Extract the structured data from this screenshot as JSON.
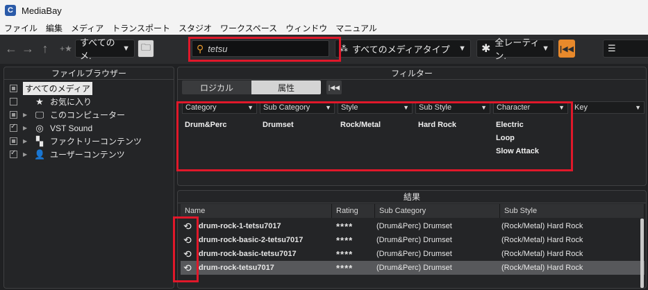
{
  "window": {
    "title": "MediaBay"
  },
  "menu": [
    "ファイル",
    "編集",
    "メディア",
    "トランスポート",
    "スタジオ",
    "ワークスペース",
    "ウィンドウ",
    "マニュアル"
  ],
  "toolbar": {
    "location_label": "すべてのメ.",
    "search_value": "tetsu",
    "media_type": "すべてのメディアタイプ",
    "rating": "全レーティン."
  },
  "browser": {
    "title": "ファイルブラウザー",
    "items": [
      {
        "label": "すべてのメディア",
        "check": "partial",
        "arrow": false,
        "icon": ""
      },
      {
        "label": "お気に入り",
        "check": "none",
        "arrow": false,
        "icon": "★"
      },
      {
        "label": "このコンピューター",
        "check": "partial",
        "arrow": true,
        "icon": "🖵"
      },
      {
        "label": "VST Sound",
        "check": "checked",
        "arrow": true,
        "icon": "◎"
      },
      {
        "label": "ファクトリーコンテンツ",
        "check": "partial",
        "arrow": true,
        "icon": "▚"
      },
      {
        "label": "ユーザーコンテンツ",
        "check": "checked",
        "arrow": true,
        "icon": "👤"
      }
    ]
  },
  "filter": {
    "title": "フィルター",
    "tab_logical": "ロジカル",
    "tab_attribute": "属性",
    "columns": [
      {
        "label": "Category",
        "values": [
          "Drum&Perc"
        ]
      },
      {
        "label": "Sub Category",
        "values": [
          "Drumset"
        ]
      },
      {
        "label": "Style",
        "values": [
          "Rock/Metal"
        ]
      },
      {
        "label": "Sub Style",
        "values": [
          "Hard Rock"
        ]
      },
      {
        "label": "Character",
        "values": [
          "Electric",
          "Loop",
          "Slow Attack"
        ]
      },
      {
        "label": "Key",
        "values": []
      }
    ]
  },
  "results": {
    "title": "結果",
    "columns": [
      "Name",
      "Rating",
      "Sub Category",
      "Sub Style"
    ],
    "rows": [
      {
        "name": "drum-rock-1-tetsu7017",
        "rating": "****",
        "sub_category": "(Drum&Perc) Drumset",
        "sub_style": "(Rock/Metal) Hard Rock",
        "selected": false
      },
      {
        "name": "drum-rock-basic-2-tetsu7017",
        "rating": "****",
        "sub_category": "(Drum&Perc) Drumset",
        "sub_style": "(Rock/Metal) Hard Rock",
        "selected": false
      },
      {
        "name": "drum-rock-basic-tetsu7017",
        "rating": "****",
        "sub_category": "(Drum&Perc) Drumset",
        "sub_style": "(Rock/Metal) Hard Rock",
        "selected": false
      },
      {
        "name": "drum-rock-tetsu7017",
        "rating": "****",
        "sub_category": "(Drum&Perc) Drumset",
        "sub_style": "(Rock/Metal) Hard Rock",
        "selected": true
      }
    ]
  },
  "colors": {
    "highlight": "#e0182a",
    "accent": "#e79a2e"
  }
}
